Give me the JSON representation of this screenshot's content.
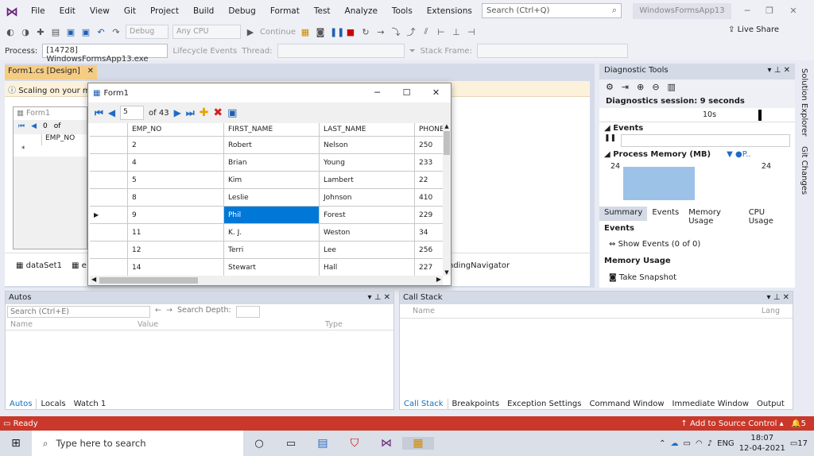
{
  "menu": [
    "File",
    "Edit",
    "View",
    "Git",
    "Project",
    "Build",
    "Debug",
    "Format",
    "Test",
    "Analyze",
    "Tools",
    "Extensions",
    "Window",
    "Help"
  ],
  "search": {
    "placeholder": "Search (Ctrl+Q)"
  },
  "app_title": "WindowsFormsApp13",
  "toolbar": {
    "config": "Debug",
    "platform": "Any CPU",
    "continue": "Continue",
    "live_share": "Live Share"
  },
  "toolbar2": {
    "process_label": "Process:",
    "process_value": "[14728] WindowsFormsApp13.exe",
    "lifecycle": "Lifecycle Events",
    "thread": "Thread:",
    "stack_frame": "Stack Frame:"
  },
  "doc_tab": {
    "label": "Form1.cs [Design]"
  },
  "scaling_msg": "Scaling on your ma",
  "design_form": {
    "title": "Form1",
    "pos": "0",
    "of": "of",
    "col": "EMP_NO"
  },
  "tray": {
    "dataset": "dataSet1",
    "e": "e",
    "navigator": "ndingNavigator"
  },
  "form1": {
    "title": "Form1",
    "position": "5",
    "count": "of 43",
    "columns": [
      "EMP_NO",
      "FIRST_NAME",
      "LAST_NAME",
      "PHONE"
    ],
    "rows": [
      [
        "2",
        "Robert",
        "Nelson",
        "250"
      ],
      [
        "4",
        "Brian",
        "Young",
        "233"
      ],
      [
        "5",
        "Kim",
        "Lambert",
        "22"
      ],
      [
        "8",
        "Leslie",
        "Johnson",
        "410"
      ],
      [
        "9",
        "Phil",
        "Forest",
        "229"
      ],
      [
        "11",
        "K. J.",
        "Weston",
        "34"
      ],
      [
        "12",
        "Terri",
        "Lee",
        "256"
      ],
      [
        "14",
        "Stewart",
        "Hall",
        "227"
      ]
    ]
  },
  "diag": {
    "title": "Diagnostic Tools",
    "session": "Diagnostics session: 9 seconds",
    "tick": "10s",
    "events": "Events",
    "process_memory": "Process Memory (MB)",
    "legend": "P..",
    "mem_left": "24",
    "mem_right": "24",
    "tabs": [
      "Summary",
      "Events",
      "Memory Usage",
      "CPU Usage"
    ],
    "sum_events": "Events",
    "show_events": "Show Events (0 of 0)",
    "memory_usage": "Memory Usage",
    "take_snapshot": "Take Snapshot"
  },
  "side_rail": [
    "Solution Explorer",
    "Git Changes"
  ],
  "autos": {
    "title": "Autos",
    "search_placeholder": "Search (Ctrl+E)",
    "search_depth": "Search Depth:",
    "cols": [
      "Name",
      "Value",
      "Type"
    ],
    "tabs": [
      "Autos",
      "Locals",
      "Watch 1"
    ]
  },
  "callstack": {
    "title": "Call Stack",
    "cols": [
      "Name",
      "Lang"
    ],
    "tabs": [
      "Call Stack",
      "Breakpoints",
      "Exception Settings",
      "Command Window",
      "Immediate Window",
      "Output"
    ]
  },
  "status": {
    "ready": "Ready",
    "source_control": "Add to Source Control",
    "notif": "5"
  },
  "taskbar": {
    "search": "Type here to search",
    "lang": "ENG",
    "time": "18:07",
    "date": "12-04-2021",
    "notif": "17"
  }
}
